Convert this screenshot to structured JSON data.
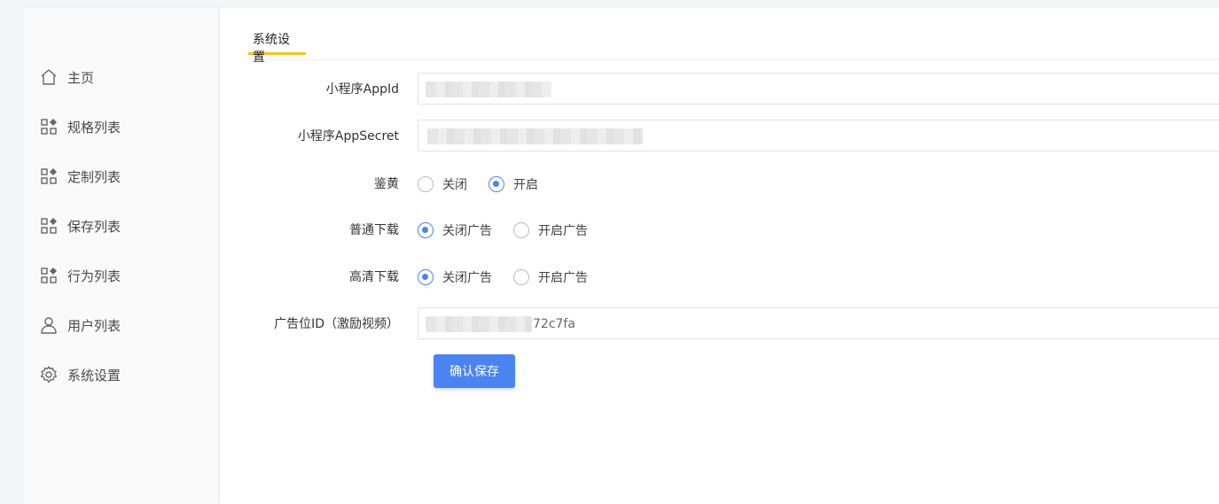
{
  "sidebar": {
    "items": [
      {
        "label": "主页",
        "icon": "home-icon"
      },
      {
        "label": "规格列表",
        "icon": "grid-icon"
      },
      {
        "label": "定制列表",
        "icon": "grid-icon"
      },
      {
        "label": "保存列表",
        "icon": "grid-icon"
      },
      {
        "label": "行为列表",
        "icon": "grid-icon"
      },
      {
        "label": "用户列表",
        "icon": "user-icon"
      },
      {
        "label": "系统设置",
        "icon": "gear-icon"
      }
    ]
  },
  "tabs": [
    {
      "label": "系统设置",
      "active": true
    }
  ],
  "form": {
    "appid_label": "小程序AppId",
    "appsecret_label": "小程序AppSecret",
    "review_label": "鉴黄",
    "review_options": [
      "关闭",
      "开启"
    ],
    "review_selected": "开启",
    "normal_download_label": "普通下载",
    "normal_download_options": [
      "关闭广告",
      "开启广告"
    ],
    "normal_download_selected": "关闭广告",
    "hd_download_label": "高清下载",
    "hd_download_options": [
      "关闭广告",
      "开启广告"
    ],
    "hd_download_selected": "关闭广告",
    "ad_id_label": "广告位ID（激励视频）",
    "ad_id_visible_suffix": "72c7fa",
    "save_label": "确认保存"
  },
  "colors": {
    "accent": "#4b83f0",
    "tab_underline": "#f5c518"
  }
}
